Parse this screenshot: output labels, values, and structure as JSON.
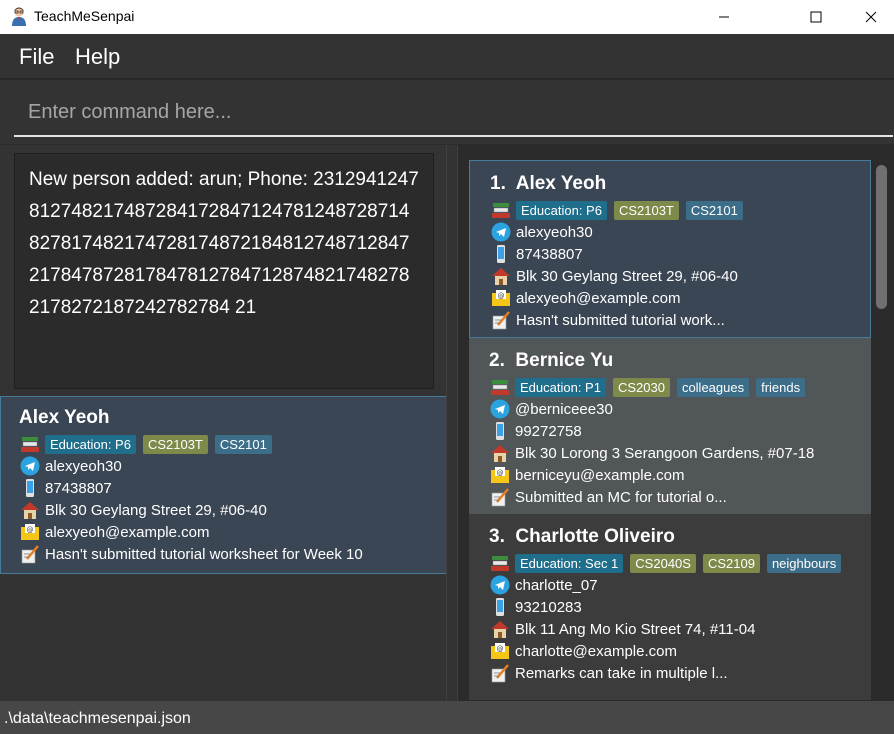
{
  "window": {
    "title": "TeachMeSenpai",
    "app_icon": "teacher-icon",
    "controls": [
      "minimize-icon",
      "maximize-icon",
      "close-icon"
    ]
  },
  "menu": {
    "file": "File",
    "help": "Help"
  },
  "command": {
    "placeholder": "Enter command here..."
  },
  "result": {
    "text": "New person added: arun; Phone: 23129412478127482174872841728471247812487287148278174821747281748721848127487128472178478728178478127847128748217482782178272187242782784 21"
  },
  "detail": {
    "name": "Alex Yeoh",
    "tags": [
      {
        "label": "Education: P6",
        "kind": "edu"
      },
      {
        "label": "CS2103T",
        "kind": "mod"
      },
      {
        "label": "CS2101",
        "kind": "other"
      }
    ],
    "telegram": "alexyeoh30",
    "phone": "87438807",
    "address": "Blk 30 Geylang Street 29, #06-40",
    "email": "alexyeoh@example.com",
    "remark": "Hasn't submitted tutorial worksheet for Week 10"
  },
  "persons": [
    {
      "index": "1.",
      "name": "Alex Yeoh",
      "tags": [
        {
          "label": "Education: P6",
          "kind": "edu"
        },
        {
          "label": "CS2103T",
          "kind": "mod"
        },
        {
          "label": "CS2101",
          "kind": "other"
        }
      ],
      "telegram": "alexyeoh30",
      "phone": "87438807",
      "address": "Blk 30 Geylang Street 29, #06-40",
      "email": "alexyeoh@example.com",
      "remark": "Hasn't submitted tutorial work..."
    },
    {
      "index": "2.",
      "name": "Bernice Yu",
      "tags": [
        {
          "label": "Education: P1",
          "kind": "edu"
        },
        {
          "label": "CS2030",
          "kind": "mod"
        },
        {
          "label": "colleagues",
          "kind": "other"
        },
        {
          "label": "friends",
          "kind": "other"
        }
      ],
      "telegram": "@berniceee30",
      "phone": "99272758",
      "address": "Blk 30 Lorong 3 Serangoon Gardens, #07-18",
      "email": "berniceyu@example.com",
      "remark": "Submitted an MC for tutorial o..."
    },
    {
      "index": "3.",
      "name": "Charlotte Oliveiro",
      "tags": [
        {
          "label": "Education: Sec 1",
          "kind": "edu"
        },
        {
          "label": "CS2040S",
          "kind": "mod"
        },
        {
          "label": "CS2109",
          "kind": "mod"
        },
        {
          "label": "neighbours",
          "kind": "other"
        }
      ],
      "telegram": "charlotte_07",
      "phone": "93210283",
      "address": "Blk 11 Ang Mo Kio Street 74, #11-04",
      "email": "charlotte@example.com",
      "remark": "Remarks can take in multiple l..."
    }
  ],
  "status": {
    "path": ".\\data\\teachmesenpai.json"
  },
  "colors": {
    "background": "#2b2b2b",
    "selected_card": "#3b4654",
    "tag_education": "#1f6e8c",
    "tag_module": "#7d8a4a",
    "tag_other": "#3c6e8a"
  },
  "icons": {
    "education": "books-icon",
    "telegram": "telegram-icon",
    "phone": "phone-icon",
    "address": "house-icon",
    "email": "email-icon",
    "remark": "remark-icon"
  }
}
